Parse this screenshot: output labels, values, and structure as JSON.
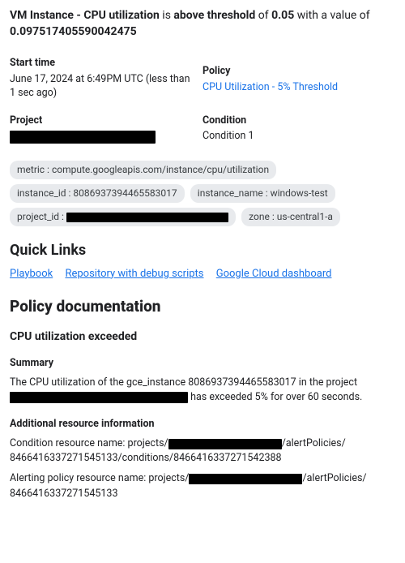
{
  "headline": {
    "resource": "VM Instance - CPU utilization",
    "mid1": " is ",
    "state": "above threshold",
    "mid2": " of ",
    "threshold": "0.05",
    "mid3": " with a value of ",
    "value": "0.097517405590042475"
  },
  "meta": {
    "start_time_label": "Start time",
    "start_time_value": "June 17, 2024 at 6:49PM UTC (less than 1 sec ago)",
    "policy_label": "Policy",
    "policy_link": "CPU Utilization - 5% Threshold",
    "project_label": "Project",
    "condition_label": "Condition",
    "condition_value": "Condition 1"
  },
  "chips": {
    "metric": "metric : compute.googleapis.com/instance/cpu/utilization",
    "instance_id": "instance_id : 8086937394465583017",
    "instance_name": "instance_name : windows-test",
    "project_id_prefix": "project_id : ",
    "zone": "zone : us-central1-a"
  },
  "quick_links": {
    "heading": "Quick Links",
    "playbook": "Playbook",
    "repo": "Repository with debug scripts",
    "dashboard": "Google Cloud dashboard"
  },
  "doc": {
    "heading": "Policy documentation",
    "sub_heading": "CPU utilization exceeded",
    "summary_heading": "Summary",
    "summary_pre": "The CPU utilization of the gce_instance 8086937394465583017 in the project ",
    "summary_post": " has exceeded 5% for over 60 seconds.",
    "additional_heading": "Additional resource information",
    "cond_pre": "Condition resource name: projects/",
    "cond_mid": "/alertPolicies/",
    "cond_suffix": "8466416337271545133/conditions/8466416337271542388",
    "policy_pre": "Alerting policy resource name: projects/",
    "policy_mid": "/alertPolicies/",
    "policy_suffix": "8466416337271545133"
  }
}
